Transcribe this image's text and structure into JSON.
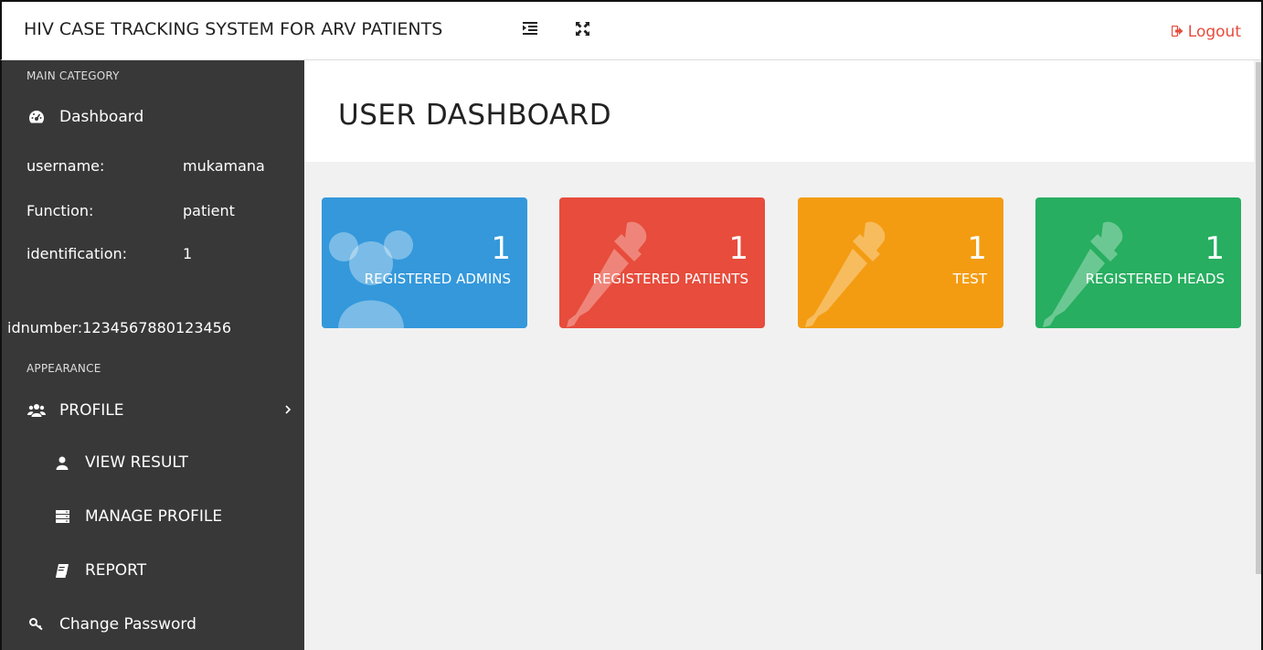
{
  "header": {
    "title": "HIV CASE TRACKING SYSTEM FOR ARV PATIENTS",
    "menu_toggle_icon": "indent-icon",
    "fullscreen_icon": "expand-icon",
    "logout_label": "Logout",
    "logout_color": "#e74c3c"
  },
  "sidebar": {
    "main_category_label": "MAIN CATEGORY",
    "dashboard_label": "Dashboard",
    "username_label": "username:",
    "username_value": "mukamana",
    "function_label": "Function:",
    "function_value": "patient",
    "identification_label": "identification:",
    "identification_value": "1",
    "idnumber_text": "idnumber:1234567880123456",
    "appearance_label": "APPEARANCE",
    "items": [
      {
        "label": "PROFILE",
        "icon": "users-icon"
      },
      {
        "label": "VIEW RESULT",
        "icon": "user-icon"
      },
      {
        "label": "MANAGE PROFILE",
        "icon": "server-icon"
      },
      {
        "label": "REPORT",
        "icon": "book-icon"
      },
      {
        "label": "Change Password",
        "icon": "key-icon"
      }
    ],
    "background": "#383838"
  },
  "main": {
    "page_title": "USER DASHBOARD"
  },
  "cards": [
    {
      "value": "1",
      "label": "REGISTERED ADMINS",
      "color": "#3498db",
      "icon": "users-icon"
    },
    {
      "value": "1",
      "label": "REGISTERED PATIENTS",
      "color": "#e74c3c",
      "icon": "eyedropper-icon"
    },
    {
      "value": "1",
      "label": "TEST",
      "color": "#f39c12",
      "icon": "eyedropper-icon"
    },
    {
      "value": "1",
      "label": "REGISTERED HEADS",
      "color": "#27ae60",
      "icon": "eyedropper-icon"
    }
  ]
}
